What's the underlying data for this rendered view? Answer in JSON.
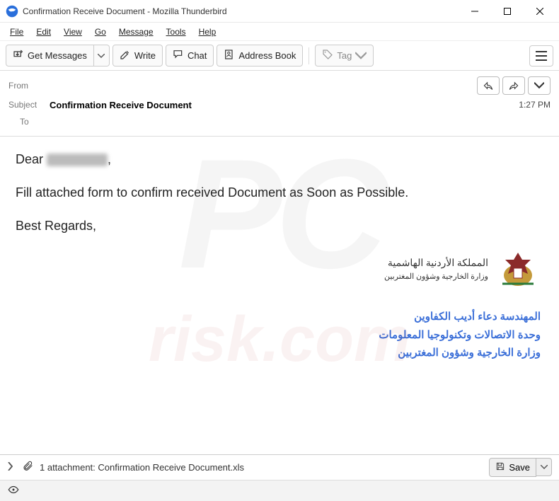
{
  "window": {
    "title": "Confirmation Receive Document - Mozilla Thunderbird"
  },
  "menu": {
    "file": "File",
    "edit": "Edit",
    "view": "View",
    "go": "Go",
    "message": "Message",
    "tools": "Tools",
    "help": "Help"
  },
  "toolbar": {
    "get_messages": "Get Messages",
    "write": "Write",
    "chat": "Chat",
    "address_book": "Address Book",
    "tag": "Tag"
  },
  "headers": {
    "from_label": "From",
    "from_value": "",
    "subject_label": "Subject",
    "subject_value": "Confirmation Receive Document",
    "to_label": "To",
    "to_value": "",
    "time": "1:27 PM"
  },
  "body": {
    "greeting_prefix": "Dear ",
    "greeting_suffix": ",",
    "line1": "Fill attached form to confirm received Document as Soon as Possible.",
    "closing": "Best Regards,"
  },
  "signature": {
    "top_line1": "المملكة الأردنية الهاشمية",
    "top_line2": "وزارة الخارجية وشؤون المغتربين",
    "line1": "المهندسة دعاء أديب الكفاوين",
    "line2": "وحدة الاتصالات وتكنولوجيا المعلومات",
    "line3": "وزارة الخارجية وشؤون المغتربين"
  },
  "attachment": {
    "summary": "1 attachment: Confirmation Receive Document.xls",
    "save_label": "Save"
  },
  "watermark": {
    "big": "PC",
    "small": "risk.com"
  }
}
